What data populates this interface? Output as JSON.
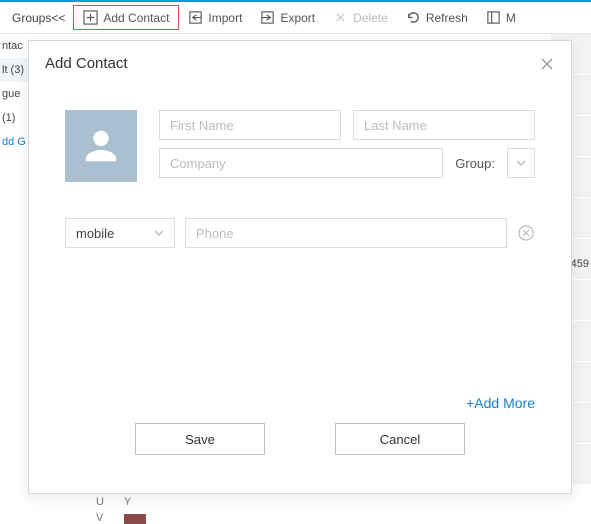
{
  "top": {
    "groups_toggle": "Groups<<",
    "buttons": {
      "add_contact": "Add Contact",
      "import": "Import",
      "export": "Export",
      "delete": "Delete",
      "refresh": "Refresh",
      "m": "M"
    }
  },
  "sidebar": {
    "items": [
      "ntac",
      "lt (3)",
      "gue",
      " (1)"
    ],
    "add_group": "dd G"
  },
  "right_snip": "459",
  "bottom": {
    "u": "U",
    "v": "V",
    "y": "Y"
  },
  "modal": {
    "title": "Add Contact",
    "placeholders": {
      "first_name": "First Name",
      "last_name": "Last Name",
      "company": "Company",
      "phone": "Phone"
    },
    "labels": {
      "group": "Group:"
    },
    "phone_type": {
      "selected": "mobile"
    },
    "add_more": "+Add More",
    "buttons": {
      "save": "Save",
      "cancel": "Cancel"
    }
  }
}
